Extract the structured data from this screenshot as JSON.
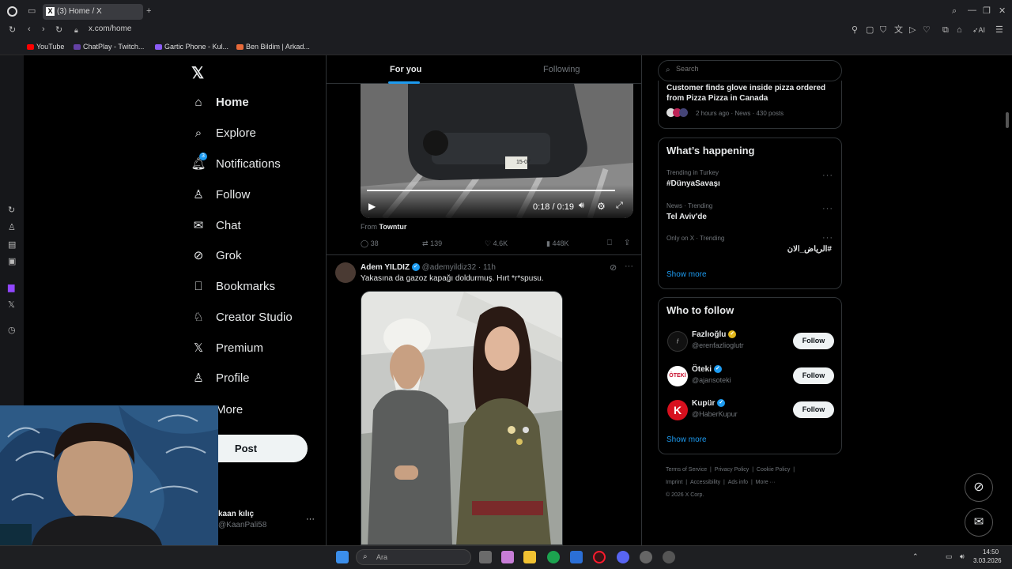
{
  "browser": {
    "tab_title": "(3) Home / X",
    "url": "x.com/home",
    "bookmarks": [
      "YouTube",
      "ChatPlay - Twitch...",
      "Gartic Phone - Kul...",
      "Ben Bildim | Arkad..."
    ],
    "extensions_label": "AI"
  },
  "nav": {
    "items": [
      "Home",
      "Explore",
      "Notifications",
      "Follow",
      "Chat",
      "Grok",
      "Bookmarks",
      "Creator Studio",
      "Premium",
      "Profile",
      "More"
    ],
    "notifications_badge": "3",
    "post_label": "Post",
    "account_name": "kaan kılıç",
    "account_handle": "@KaanPali58"
  },
  "feed": {
    "tabs": [
      "For you",
      "Following"
    ],
    "video": {
      "time": "0:18 / 0:19",
      "plate": "15-07",
      "from_prefix": "From",
      "from_name": "Towntur",
      "progress": 0.95
    },
    "tweet1_stats": {
      "replies": "38",
      "reposts": "139",
      "likes": "4.6K",
      "views": "448K"
    },
    "tweet2": {
      "name": "Adem YILDIZ",
      "handle": "@ademyildiz32",
      "time": "· 11h",
      "text": "Yakasına da gazoz kapağı doldurmuş. Hırt *r*spusu."
    }
  },
  "right": {
    "search_placeholder": "Search",
    "news": {
      "title": "Customer finds glove inside pizza ordered from Pizza Pizza in Canada",
      "meta": "2 hours ago · News · 430 posts"
    },
    "happening": {
      "title": "What’s happening",
      "items": [
        {
          "context": "Trending in Turkey",
          "topic": "#DünyaSavaşı"
        },
        {
          "context": "News · Trending",
          "topic": "Tel Aviv'de"
        },
        {
          "context": "Only on X · Trending",
          "topic": "#الرياض_الان"
        }
      ],
      "show_more": "Show more"
    },
    "who_to_follow": {
      "title": "Who to follow",
      "accounts": [
        {
          "name": "Fazlıoğlu",
          "handle": "@erenfazlioglutr"
        },
        {
          "name": "Öteki",
          "handle": "@ajansoteki"
        },
        {
          "name": "Kupür",
          "handle": "@HaberKupur"
        }
      ],
      "follow_label": "Follow",
      "show_more": "Show more"
    },
    "footer": {
      "links": [
        "Terms of Service",
        "|",
        "Privacy Policy",
        "|",
        "Cookie Policy",
        "|",
        "Imprint",
        "|",
        "Accessibility",
        "|",
        "Ads info",
        "|",
        "More ···"
      ],
      "copyright": "© 2026 X Corp."
    }
  },
  "taskbar": {
    "search_placeholder": "Ara",
    "time": "14:50",
    "date": "3.03.2026"
  },
  "colors": {
    "accent": "#1d9bf0",
    "background": "#000000",
    "border": "#2f3336"
  }
}
